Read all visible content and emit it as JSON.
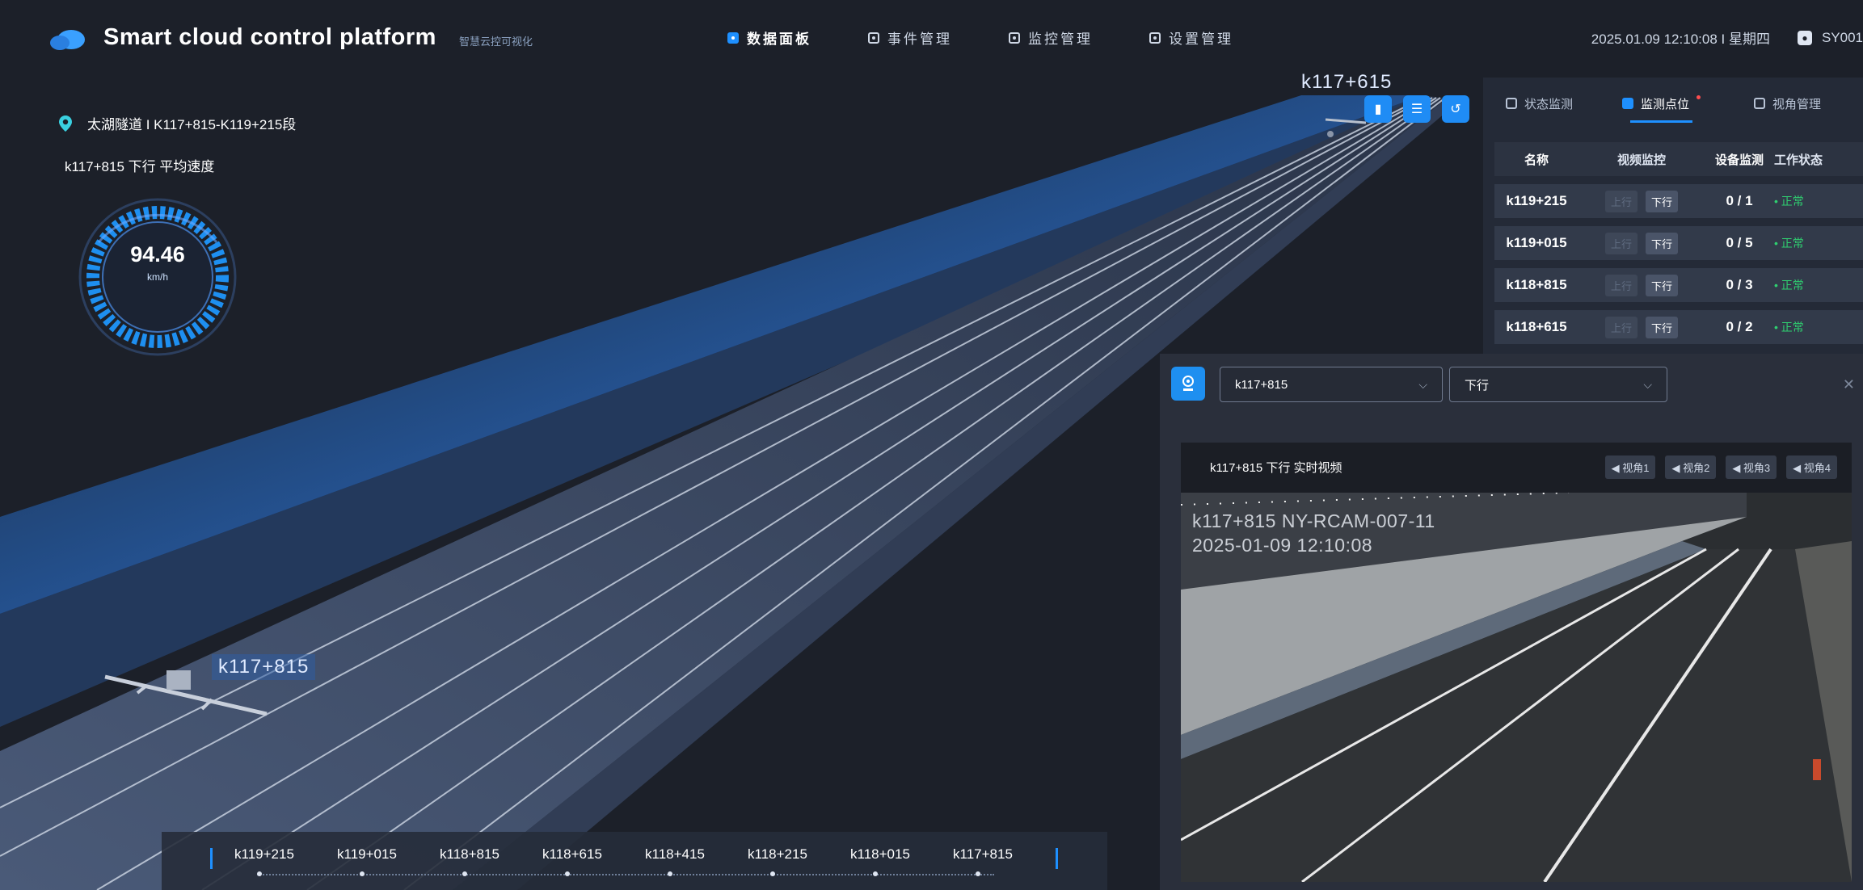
{
  "header": {
    "title": "Smart cloud control platform",
    "subtitle": "智慧云控可视化",
    "nav": [
      {
        "label": "数据面板",
        "active": true
      },
      {
        "label": "事件管理",
        "active": false
      },
      {
        "label": "监控管理",
        "active": false
      },
      {
        "label": "设置管理",
        "active": false
      }
    ],
    "datetime": "2025.01.09 12:10:08 I 星期四",
    "user": "SY001"
  },
  "location": {
    "text": "太湖隧道 I K117+815-K119+215段"
  },
  "speed": {
    "title": "k117+815 下行 平均速度",
    "value": "94.46",
    "unit": "km/h"
  },
  "map": {
    "near_label": "k117+815",
    "far_label": "k117+615"
  },
  "panel": {
    "tabs": [
      {
        "label": "状态监测"
      },
      {
        "label": "监测点位"
      },
      {
        "label": "视角管理"
      }
    ],
    "columns": [
      "名称",
      "视频监控",
      "设备监测",
      "工作状态"
    ],
    "rows": [
      {
        "name": "k119+215",
        "up": "上行",
        "down": "下行",
        "device": "0 / 1",
        "status": "• 正常"
      },
      {
        "name": "k119+015",
        "up": "上行",
        "down": "下行",
        "device": "0 / 5",
        "status": "• 正常"
      },
      {
        "name": "k118+815",
        "up": "上行",
        "down": "下行",
        "device": "0 / 3",
        "status": "• 正常"
      },
      {
        "name": "k118+615",
        "up": "上行",
        "down": "下行",
        "device": "0 / 2",
        "status": "• 正常"
      }
    ]
  },
  "video_window": {
    "select_point": "k117+815",
    "select_direction": "下行",
    "title": "k117+815 下行 实时视频",
    "angles": [
      "视角1",
      "视角2",
      "视角3",
      "视角4"
    ],
    "osd_line1": "k117+815 NY-RCAM-007-11",
    "osd_line2": "2025-01-09 12:10:08"
  },
  "timeline": {
    "points": [
      "k119+215",
      "k119+015",
      "k118+815",
      "k118+615",
      "k118+415",
      "k118+215",
      "k118+015",
      "k117+815"
    ]
  },
  "colors": {
    "accent": "#1e90ff",
    "ok": "#2fd070",
    "background": "#1c2029"
  }
}
